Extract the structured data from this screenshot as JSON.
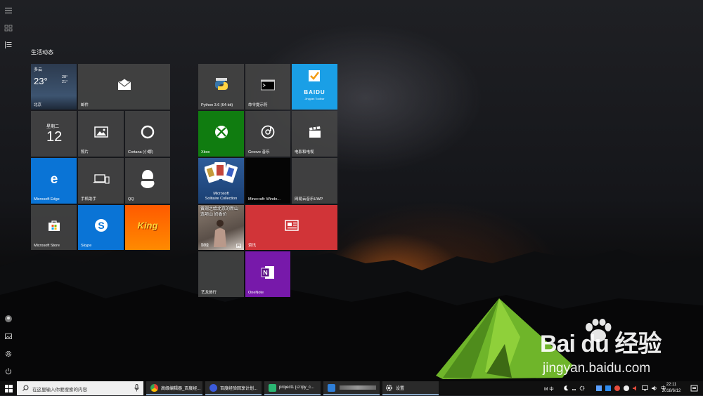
{
  "start": {
    "group_title": "生活动态",
    "tiles": {
      "weather": {
        "condition": "多云",
        "temp": "23°",
        "high": "28°",
        "low": "21°",
        "city": "北京"
      },
      "mail": {
        "label": "邮件"
      },
      "calendar": {
        "weekday": "星期二",
        "day": "12"
      },
      "photos": {
        "label": "照片"
      },
      "cortana": {
        "label": "Cortana (小娜)"
      },
      "edge": {
        "label": "Microsoft Edge"
      },
      "phone": {
        "label": "手机助手"
      },
      "qq": {
        "label": "QQ"
      },
      "store": {
        "label": "Microsoft Store"
      },
      "skype": {
        "label": "Skype"
      },
      "king": {
        "label": "King"
      },
      "python": {
        "label": "Python 3.6 (64-bit)"
      },
      "cmd": {
        "label": "命令提示符"
      },
      "baidu": {
        "label": "BAIDU",
        "sub": "Jingyan Toolbar"
      },
      "xbox": {
        "label": "Xbox"
      },
      "groove": {
        "label": "Groove 音乐"
      },
      "movies": {
        "label": "电影和电视"
      },
      "solitaire": {
        "label_line1": "Microsoft",
        "label_line2": "Solitaire Collection"
      },
      "minecraft": {
        "label": "Minecraft: Windo..."
      },
      "netease": {
        "label": "网易云音乐UWP"
      },
      "finance": {
        "headline": "黄琬之给北京的新山 选项山 奶香价",
        "label": "财经"
      },
      "news": {
        "label": "资讯"
      },
      "yilong": {
        "label": "艺龙旅行"
      },
      "onenote": {
        "label": "OneNote"
      }
    }
  },
  "taskbar": {
    "search_placeholder": "在这里输入你要搜索的内容",
    "apps": [
      {
        "title": "高级编辑器_百度经...",
        "color": "#e94235"
      },
      {
        "title": "百度经验回享计划...",
        "color": "#3b5bdb"
      },
      {
        "title": "project1 [D:\\py_c...",
        "color": "#2bb673"
      },
      {
        "title": "",
        "color": "#2f7fd8"
      },
      {
        "title": "设置",
        "color": ""
      }
    ],
    "tray_ime": "M 中",
    "time": "22:11",
    "date": "2018/6/12"
  },
  "watermark": {
    "brand": "Bai du 经验",
    "url": "jingyan.baidu.com"
  }
}
